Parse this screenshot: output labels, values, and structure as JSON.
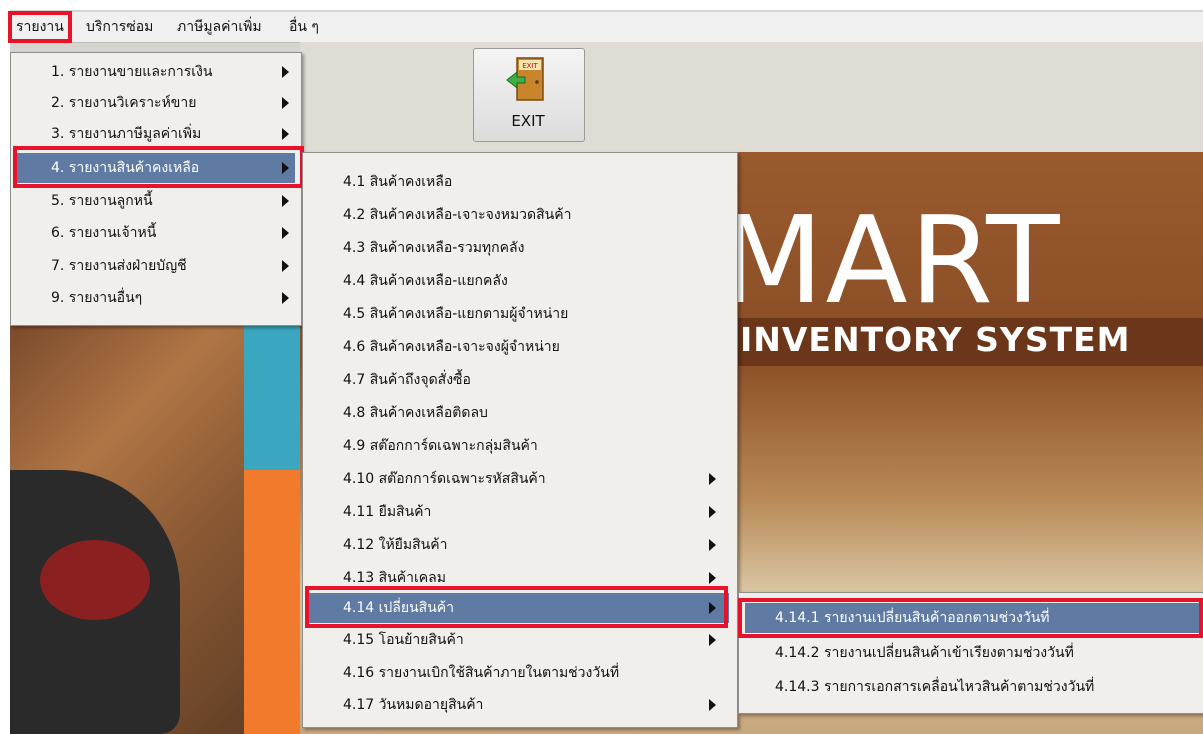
{
  "menubar": {
    "items": [
      "รายงาน",
      "บริการซ่อม",
      "ภาษีมูลค่าเพิ่ม",
      "อื่น ๆ"
    ]
  },
  "toolbar": {
    "exit_label": "EXIT",
    "exit_sign": "EXIT"
  },
  "banner": {
    "brand": "MART",
    "tagline": "INVENTORY SYSTEM"
  },
  "menu_reports": {
    "items": [
      "1. รายงานขายและการเงิน",
      "2. รายงานวิเคราะห์ขาย",
      "3. รายงานภาษีมูลค่าเพิ่ม",
      "4. รายงานสินค้าคงเหลือ",
      "5. รายงานลูกหนี้",
      "6. รายงานเจ้าหนี้",
      "7. รายงานส่งฝ่ายบัญชี",
      "9. รายงานอื่นๆ"
    ],
    "selected_index": 3
  },
  "menu_inventory": {
    "items": [
      "4.1 สินค้าคงเหลือ",
      "4.2 สินค้าคงเหลือ-เจาะจงหมวดสินค้า",
      "4.3 สินค้าคงเหลือ-รวมทุกคลัง",
      "4.4 สินค้าคงเหลือ-แยกคลัง",
      "4.5 สินค้าคงเหลือ-แยกตามผู้จำหน่าย",
      "4.6 สินค้าคงเหลือ-เจาะจงผู้จำหน่าย",
      "4.7 สินค้าถึงจุดสั่งซื้อ",
      "4.8 สินค้าคงเหลือติดลบ",
      "4.9 สต๊อกการ์ดเฉพาะกลุ่มสินค้า",
      "4.10 สต๊อกการ์ดเฉพาะรหัสสินค้า",
      "4.11 ยืมสินค้า",
      "4.12 ให้ยืมสินค้า",
      "4.13 สินค้าเคลม",
      "4.14 เปลี่ยนสินค้า",
      "4.15 โอนย้ายสินค้า",
      "4.16 รายงานเบิกใช้สินค้าภายในตามช่วงวันที่",
      "4.17 วันหมดอายุสินค้า"
    ],
    "selected_index": 13
  },
  "menu_exchange": {
    "items": [
      "4.14.1 รายงานเปลี่ยนสินค้าออกตามช่วงวันที่",
      "4.14.2 รายงานเปลี่ยนสินค้าเข้าเรียงตามช่วงวันที่",
      "4.14.3 รายการเอกสารเคลื่อนไหวสินค้าตามช่วงวันที่"
    ],
    "selected_index": 0
  },
  "colors": {
    "highlight": "#e8132a",
    "selection": "#5f7ba4",
    "menu_bg": "#f0efec"
  }
}
